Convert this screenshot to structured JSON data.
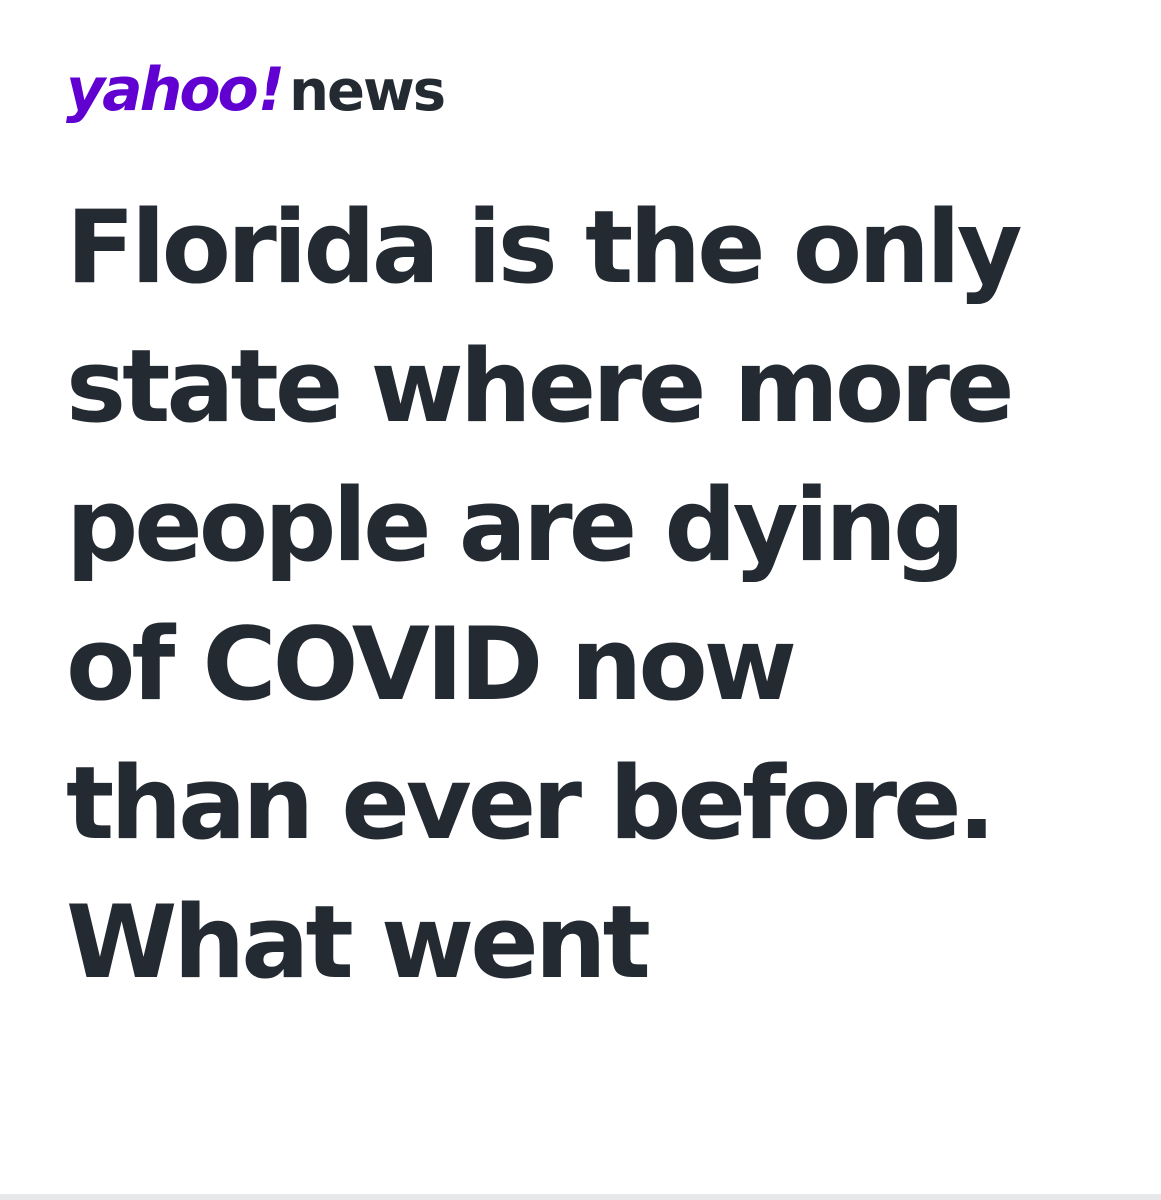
{
  "brand": {
    "logo_yahoo": "yahoo",
    "logo_bang": "!",
    "logo_news": "news",
    "colors": {
      "yahoo_purple": "#6001d2",
      "text_dark": "#232a31",
      "background": "#ffffff"
    }
  },
  "article": {
    "headline_lines": [
      "Florida is the only",
      "state where more",
      "people are dying",
      "of COVID now",
      "than ever before.",
      "What went"
    ]
  }
}
